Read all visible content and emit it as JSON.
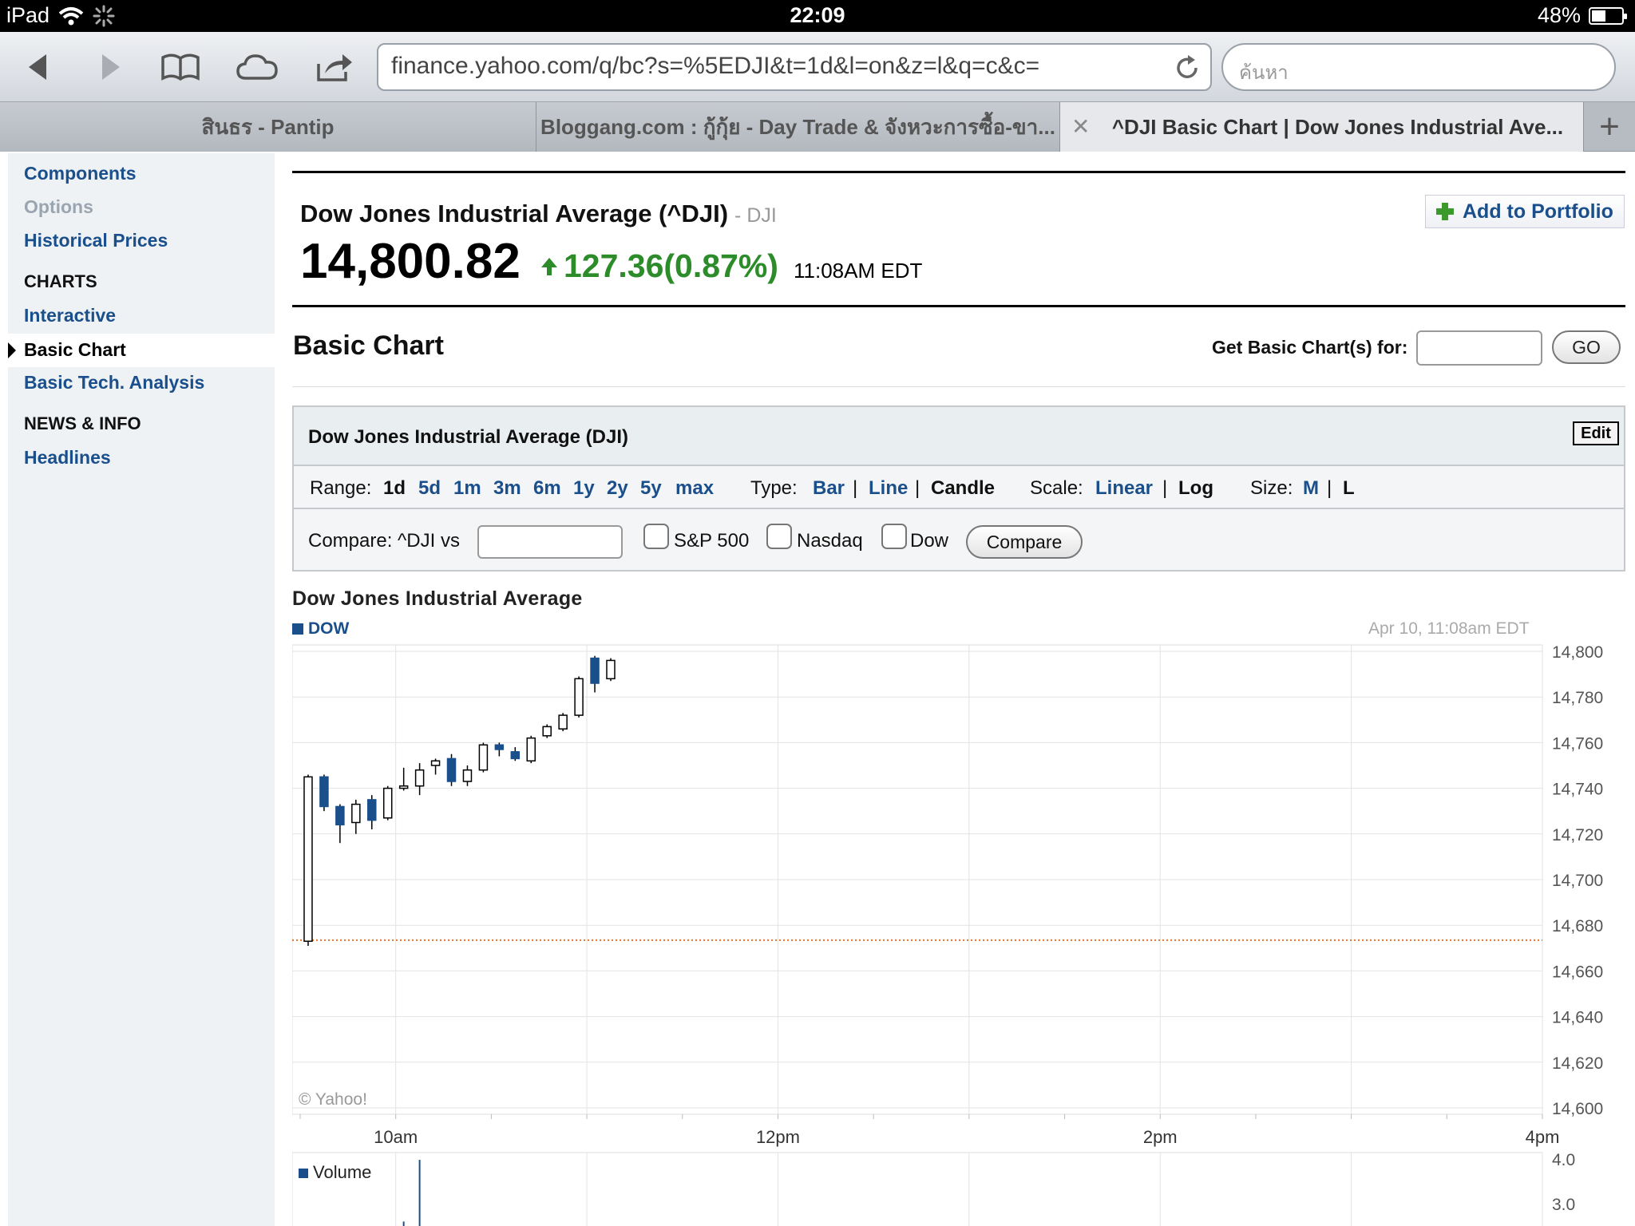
{
  "status_bar": {
    "device": "iPad",
    "time": "22:09",
    "battery": "48%",
    "battery_level": 0.48
  },
  "browser": {
    "url": "finance.yahoo.com/q/bc?s=%5EDJI&t=1d&l=on&z=l&q=c&c=",
    "search_placeholder": "ค้นหา",
    "tabs": [
      {
        "label": "สินธร - Pantip"
      },
      {
        "label": "Bloggang.com : กู้กุ้ย - Day Trade & จังหวะการซื้อ-ขา..."
      },
      {
        "label": "^DJI Basic Chart | Dow Jones Industrial Ave..."
      }
    ],
    "close_glyph": "✕",
    "add_glyph": "+"
  },
  "sidebar": {
    "components": "Components",
    "options": "Options",
    "historical": "Historical Prices",
    "charts_heading": "CHARTS",
    "interactive": "Interactive",
    "basic_chart": "Basic Chart",
    "basic_tech": "Basic Tech. Analysis",
    "news_heading": "NEWS & INFO",
    "headlines": "Headlines"
  },
  "quote": {
    "name": "Dow Jones Industrial Average (^DJI)",
    "exchange": "- DJI",
    "price": "14,800.82",
    "change": "127.36(0.87%)",
    "time": "11:08AM EDT",
    "add_portfolio": "Add to Portfolio"
  },
  "basic_chart": {
    "title": "Basic Chart",
    "get_label": "Get Basic Chart(s) for:",
    "go": "GO",
    "panel_title": "Dow Jones Industrial Average (DJI)",
    "edit": "Edit",
    "range_label": "Range:",
    "ranges": [
      "1d",
      "5d",
      "1m",
      "3m",
      "6m",
      "1y",
      "2y",
      "5y",
      "max"
    ],
    "type_label": "Type:",
    "types": [
      "Bar",
      "Line",
      "Candle"
    ],
    "scale_label": "Scale:",
    "scales": [
      "Linear",
      "Log"
    ],
    "size_label": "Size:",
    "sizes": [
      "M",
      "L"
    ],
    "sep": "|",
    "compare_label": "Compare: ^DJI vs",
    "sp500": "S&P 500",
    "nasdaq": "Nasdaq",
    "dow": "Dow",
    "compare_btn": "Compare"
  },
  "chart_data": {
    "type": "candlestick",
    "title": "Dow Jones Industrial Average",
    "legend": "DOW",
    "timestamp": "Apr 10, 11:08am EDT",
    "watermark": "© Yahoo!",
    "ylim": [
      14600,
      14800
    ],
    "yticks": [
      14800,
      14780,
      14760,
      14740,
      14720,
      14700,
      14680,
      14660,
      14640,
      14620,
      14600
    ],
    "ytick_labels": [
      "14,800",
      "14,780",
      "14,760",
      "14,740",
      "14,720",
      "14,700",
      "14,680",
      "14,660",
      "14,640",
      "14,620",
      "14,600"
    ],
    "xlim": [
      0,
      390
    ],
    "xticks": [
      {
        "t": 30,
        "label": "10am"
      },
      {
        "t": 150,
        "label": "12pm"
      },
      {
        "t": 270,
        "label": "2pm"
      },
      {
        "t": 390,
        "label": "4pm"
      }
    ],
    "prev_close": 14673.46,
    "candles": [
      {
        "t": 2.5,
        "o": 14673,
        "h": 14746,
        "l": 14671,
        "c": 14745
      },
      {
        "t": 7.5,
        "o": 14745,
        "h": 14746,
        "l": 14730,
        "c": 14732
      },
      {
        "t": 12.5,
        "o": 14732,
        "h": 14733,
        "l": 14716,
        "c": 14724
      },
      {
        "t": 17.5,
        "o": 14725,
        "h": 14735,
        "l": 14720,
        "c": 14733
      },
      {
        "t": 22.5,
        "o": 14735,
        "h": 14737,
        "l": 14722,
        "c": 14726
      },
      {
        "t": 27.5,
        "o": 14727,
        "h": 14741,
        "l": 14726,
        "c": 14740
      },
      {
        "t": 32.5,
        "o": 14740,
        "h": 14749,
        "l": 14739,
        "c": 14741
      },
      {
        "t": 37.5,
        "o": 14741,
        "h": 14751,
        "l": 14737,
        "c": 14748
      },
      {
        "t": 42.5,
        "o": 14750,
        "h": 14753,
        "l": 14746,
        "c": 14752
      },
      {
        "t": 47.5,
        "o": 14753,
        "h": 14755,
        "l": 14741,
        "c": 14743
      },
      {
        "t": 52.5,
        "o": 14743,
        "h": 14750,
        "l": 14741,
        "c": 14748
      },
      {
        "t": 57.5,
        "o": 14748,
        "h": 14760,
        "l": 14747,
        "c": 14759
      },
      {
        "t": 62.5,
        "o": 14759,
        "h": 14760,
        "l": 14754,
        "c": 14757
      },
      {
        "t": 67.5,
        "o": 14756,
        "h": 14758,
        "l": 14752,
        "c": 14753
      },
      {
        "t": 72.5,
        "o": 14752,
        "h": 14763,
        "l": 14751,
        "c": 14762
      },
      {
        "t": 77.5,
        "o": 14763,
        "h": 14768,
        "l": 14762,
        "c": 14767
      },
      {
        "t": 82.5,
        "o": 14766,
        "h": 14773,
        "l": 14765,
        "c": 14772
      },
      {
        "t": 87.5,
        "o": 14772,
        "h": 14789,
        "l": 14771,
        "c": 14788
      },
      {
        "t": 92.5,
        "o": 14797,
        "h": 14798,
        "l": 14782,
        "c": 14786
      },
      {
        "t": 97.5,
        "o": 14788,
        "h": 14797,
        "l": 14787,
        "c": 14796
      }
    ],
    "volume": {
      "label": "Volume",
      "ytick_labels": [
        "4.0",
        "3.0"
      ],
      "yticks": [
        4.0,
        3.0
      ],
      "ylim_top": 4.0,
      "bars": [
        {
          "t": 32.5,
          "v": 2.6
        },
        {
          "t": 37.5,
          "v": 3.98
        }
      ]
    },
    "colors": {
      "up": "#ffffff",
      "down": "#1a4f8b",
      "grid": "#e3e3e3",
      "prev_close": "#e8732a"
    }
  }
}
